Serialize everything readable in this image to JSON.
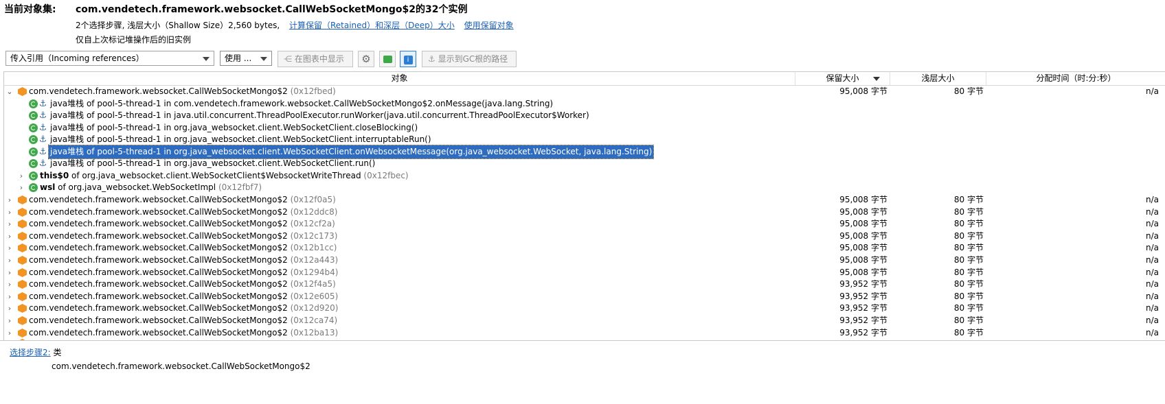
{
  "header": {
    "label": "当前对象集:",
    "class_title": "com.vendetech.framework.websocket.CallWebSocketMongo$2的32个实例",
    "steps_info": "2个选择步骤, 浅层大小（Shallow Size）2,560 bytes,",
    "link_retained": "计算保留（Retained）和深层（Deep）大小",
    "link_use_retained": "使用保留对象",
    "note": "仅自上次标记堆操作后的旧实例"
  },
  "toolbar": {
    "ref_combo": "传入引用（Incoming references）",
    "use_combo": "使用 ...",
    "show_in_graph": "在图表中显示",
    "show_gc_path": "显示到GC根的路径",
    "settings_icon": "gear-icon",
    "gc_icon": "gc-icon",
    "info_icon": "info-icon"
  },
  "table": {
    "columns": [
      "对象",
      "保留大小",
      "浅层大小",
      "分配时间（时:分:秒）"
    ],
    "expanded_row": {
      "class": "com.vendetech.framework.websocket.CallWebSocketMongo$2",
      "addr": "(0x12fbed)",
      "retained": "95,008 字节",
      "shallow": "80 字节",
      "alloc": "n/a"
    },
    "children": [
      {
        "text": "java堆栈 of pool-5-thread-1 in com.vendetech.framework.websocket.CallWebSocketMongo$2.onMessage(java.lang.String)"
      },
      {
        "text": "java堆栈 of pool-5-thread-1 in java.util.concurrent.ThreadPoolExecutor.runWorker(java.util.concurrent.ThreadPoolExecutor$Worker)"
      },
      {
        "text": "java堆栈 of pool-5-thread-1 in org.java_websocket.client.WebSocketClient.closeBlocking()"
      },
      {
        "text": "java堆栈 of pool-5-thread-1 in org.java_websocket.client.WebSocketClient.interruptableRun()"
      },
      {
        "text": "java堆栈 of pool-5-thread-1 in org.java_websocket.client.WebSocketClient.onWebsocketMessage(org.java_websocket.WebSocket, java.lang.String)"
      },
      {
        "text": "java堆栈 of pool-5-thread-1 in org.java_websocket.client.WebSocketClient.run()"
      }
    ],
    "field_refs": [
      {
        "name": "this$0",
        "of": " of org.java_websocket.client.WebSocketClient$WebsocketWriteThread ",
        "addr": "(0x12fbec)"
      },
      {
        "name": "wsl",
        "of": " of org.java_websocket.WebSocketImpl ",
        "addr": "(0x12fbf7)"
      }
    ],
    "rows": [
      {
        "class": "com.vendetech.framework.websocket.CallWebSocketMongo$2",
        "addr": "(0x12f0a5)",
        "retained": "95,008 字节",
        "shallow": "80 字节",
        "alloc": "n/a"
      },
      {
        "class": "com.vendetech.framework.websocket.CallWebSocketMongo$2",
        "addr": "(0x12ddc8)",
        "retained": "95,008 字节",
        "shallow": "80 字节",
        "alloc": "n/a"
      },
      {
        "class": "com.vendetech.framework.websocket.CallWebSocketMongo$2",
        "addr": "(0x12cf2a)",
        "retained": "95,008 字节",
        "shallow": "80 字节",
        "alloc": "n/a"
      },
      {
        "class": "com.vendetech.framework.websocket.CallWebSocketMongo$2",
        "addr": "(0x12c173)",
        "retained": "95,008 字节",
        "shallow": "80 字节",
        "alloc": "n/a"
      },
      {
        "class": "com.vendetech.framework.websocket.CallWebSocketMongo$2",
        "addr": "(0x12b1cc)",
        "retained": "95,008 字节",
        "shallow": "80 字节",
        "alloc": "n/a"
      },
      {
        "class": "com.vendetech.framework.websocket.CallWebSocketMongo$2",
        "addr": "(0x12a443)",
        "retained": "95,008 字节",
        "shallow": "80 字节",
        "alloc": "n/a"
      },
      {
        "class": "com.vendetech.framework.websocket.CallWebSocketMongo$2",
        "addr": "(0x1294b4)",
        "retained": "95,008 字节",
        "shallow": "80 字节",
        "alloc": "n/a"
      },
      {
        "class": "com.vendetech.framework.websocket.CallWebSocketMongo$2",
        "addr": "(0x12f4a5)",
        "retained": "93,952 字节",
        "shallow": "80 字节",
        "alloc": "n/a"
      },
      {
        "class": "com.vendetech.framework.websocket.CallWebSocketMongo$2",
        "addr": "(0x12e605)",
        "retained": "93,952 字节",
        "shallow": "80 字节",
        "alloc": "n/a"
      },
      {
        "class": "com.vendetech.framework.websocket.CallWebSocketMongo$2",
        "addr": "(0x12d920)",
        "retained": "93,952 字节",
        "shallow": "80 字节",
        "alloc": "n/a"
      },
      {
        "class": "com.vendetech.framework.websocket.CallWebSocketMongo$2",
        "addr": "(0x12ca74)",
        "retained": "93,952 字节",
        "shallow": "80 字节",
        "alloc": "n/a"
      },
      {
        "class": "com.vendetech.framework.websocket.CallWebSocketMongo$2",
        "addr": "(0x12ba13)",
        "retained": "93,952 字节",
        "shallow": "80 字节",
        "alloc": "n/a"
      }
    ]
  },
  "footer": {
    "step_link": "选择步骤2:",
    "step_kind": "类",
    "step_class": "com.vendetech.framework.websocket.CallWebSocketMongo$2"
  }
}
